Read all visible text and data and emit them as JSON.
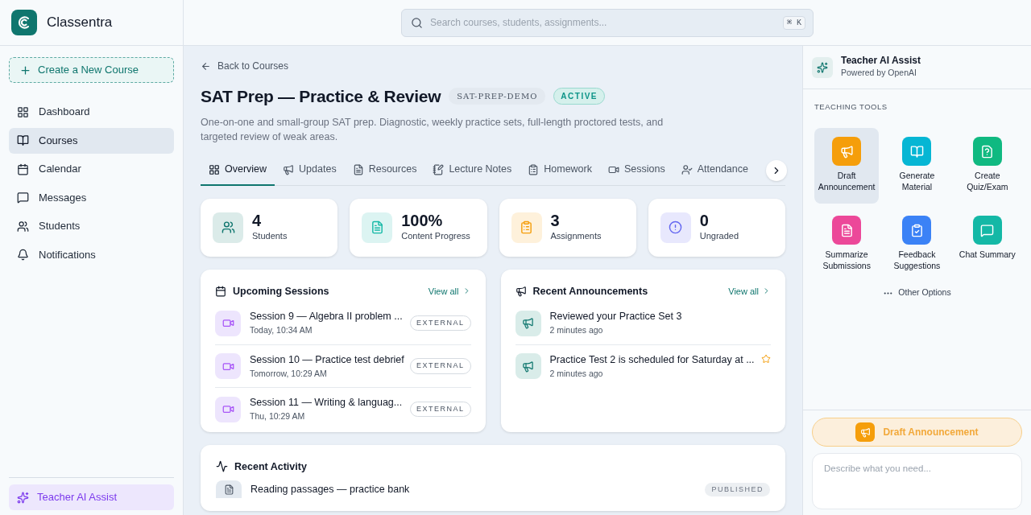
{
  "brand": {
    "name": "Classentra"
  },
  "search": {
    "placeholder": "Search courses, students, assignments...",
    "shortcut": "⌘ K"
  },
  "sidebar": {
    "create_button": "Create a New Course",
    "items": [
      {
        "label": "Dashboard",
        "selected": false
      },
      {
        "label": "Courses",
        "selected": true
      },
      {
        "label": "Calendar",
        "selected": false
      },
      {
        "label": "Messages",
        "selected": false
      },
      {
        "label": "Students",
        "selected": false
      },
      {
        "label": "Notifications",
        "selected": false
      }
    ],
    "footer_button": "Teacher AI Assist"
  },
  "course": {
    "back_link": "Back to Courses",
    "title": "SAT Prep — Practice & Review",
    "code": "SAT-PREP-DEMO",
    "status": "ACTIVE",
    "description": "One-on-one and small-group SAT prep. Diagnostic, weekly practice sets, full-length proctored tests, and targeted review of weak areas."
  },
  "tabs": [
    {
      "label": "Overview",
      "selected": true
    },
    {
      "label": "Updates",
      "selected": false
    },
    {
      "label": "Resources",
      "selected": false
    },
    {
      "label": "Lecture Notes",
      "selected": false
    },
    {
      "label": "Homework",
      "selected": false
    },
    {
      "label": "Sessions",
      "selected": false
    },
    {
      "label": "Attendance",
      "selected": false
    }
  ],
  "stats": [
    {
      "value": "4",
      "label": "Students",
      "color": "#0f766e"
    },
    {
      "value": "100%",
      "label": "Content Progress",
      "color": "#14b8a6"
    },
    {
      "value": "3",
      "label": "Assignments",
      "color": "#f59e0b"
    },
    {
      "value": "0",
      "label": "Ungraded",
      "color": "#6366f1"
    }
  ],
  "upcoming_sessions": {
    "title": "Upcoming Sessions",
    "view_all": "View all",
    "items": [
      {
        "title": "Session 9 — Algebra II problem ...",
        "time": "Today, 10:34 AM",
        "badge": "EXTERNAL"
      },
      {
        "title": "Session 10 — Practice test debrief",
        "time": "Tomorrow, 10:29 AM",
        "badge": "EXTERNAL"
      },
      {
        "title": "Session 11 — Writing & languag...",
        "time": "Thu, 10:29 AM",
        "badge": "EXTERNAL"
      }
    ]
  },
  "recent_announcements": {
    "title": "Recent Announcements",
    "view_all": "View all",
    "items": [
      {
        "title": "Reviewed your Practice Set 3",
        "time": "2 minutes ago",
        "starred": false
      },
      {
        "title": "Practice Test 2 is scheduled for Saturday at ...",
        "time": "2 minutes ago",
        "starred": true
      }
    ]
  },
  "recent_activity": {
    "title": "Recent Activity",
    "items": [
      {
        "title": "Reading passages — practice bank",
        "badge": "PUBLISHED"
      }
    ]
  },
  "assistant": {
    "title": "Teacher AI Assist",
    "subtitle": "Powered by OpenAI",
    "section_label": "TEACHING TOOLS",
    "tools": [
      {
        "label": "Draft Announcement",
        "color": "#f59e0b",
        "selected": true
      },
      {
        "label": "Generate Material",
        "color": "#06b6d4",
        "selected": false
      },
      {
        "label": "Create Quiz/Exam",
        "color": "#10b981",
        "selected": false
      },
      {
        "label": "Summarize Submissions",
        "color": "#ec4899",
        "selected": false
      },
      {
        "label": "Feedback Suggestions",
        "color": "#3b82f6",
        "selected": false
      },
      {
        "label": "Chat Summary",
        "color": "#14b8a6",
        "selected": false
      }
    ],
    "other_options": "Other Options",
    "active_tool": "Draft Announcement",
    "prompt_placeholder": "Describe what you need..."
  }
}
